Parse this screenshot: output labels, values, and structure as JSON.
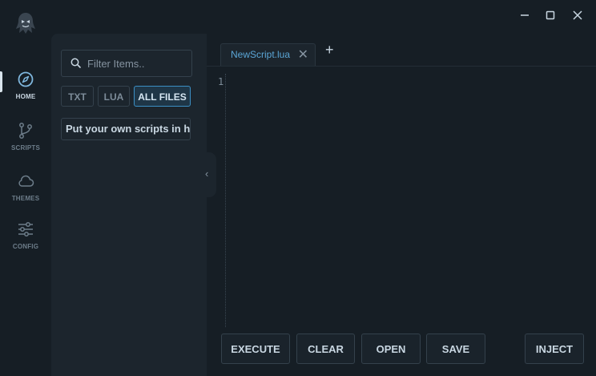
{
  "nav": {
    "items": [
      {
        "label": "HOME",
        "icon": "compass-icon",
        "active": true
      },
      {
        "label": "SCRIPTS",
        "icon": "git-branch-icon",
        "active": false
      },
      {
        "label": "THEMES",
        "icon": "cloud-icon",
        "active": false
      },
      {
        "label": "CONFIG",
        "icon": "sliders-icon",
        "active": false
      }
    ]
  },
  "sidebar": {
    "search_placeholder": "Filter Items..",
    "filters": [
      {
        "label": "TXT",
        "active": false
      },
      {
        "label": "LUA",
        "active": false
      },
      {
        "label": "ALL FILES",
        "active": true
      }
    ],
    "files": [
      "Put your own scripts in here"
    ]
  },
  "editor": {
    "tabs": [
      {
        "label": "NewScript.lua",
        "active": true
      }
    ],
    "close_symbol": "✕",
    "add_symbol": "+",
    "line_numbers": [
      "1"
    ],
    "content": ""
  },
  "actions": {
    "execute": "EXECUTE",
    "clear": "CLEAR",
    "open": "OPEN",
    "save": "SAVE",
    "inject": "INJECT"
  },
  "colors": {
    "background": "#161e25",
    "panel": "#1c252d",
    "accent": "#3b8fc4",
    "tab_text": "#5ba6d6"
  }
}
